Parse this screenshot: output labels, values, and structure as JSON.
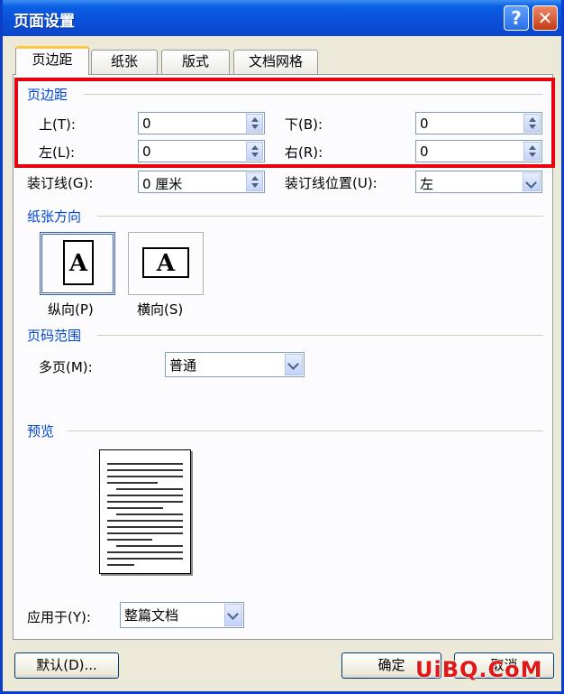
{
  "window": {
    "title": "页面设置",
    "help_glyph": "?",
    "close_glyph": "✕"
  },
  "tabs": [
    {
      "label": "页边距",
      "active": true
    },
    {
      "label": "纸张",
      "active": false
    },
    {
      "label": "版式",
      "active": false
    },
    {
      "label": "文档网格",
      "active": false
    }
  ],
  "margins": {
    "group_title": "页边距",
    "top_label": "上(T):",
    "top_value": "0",
    "bottom_label": "下(B):",
    "bottom_value": "0",
    "left_label": "左(L):",
    "left_value": "0",
    "right_label": "右(R):",
    "right_value": "0",
    "gutter_label": "装订线(G):",
    "gutter_value": "0 厘米",
    "gutter_pos_label": "装订线位置(U):",
    "gutter_pos_value": "左"
  },
  "orientation": {
    "group_title": "纸张方向",
    "glyph": "A",
    "portrait_label": "纵向(P)",
    "landscape_label": "横向(S)",
    "selected": "portrait"
  },
  "pages": {
    "group_title": "页码范围",
    "multiple_label": "多页(M):",
    "multiple_value": "普通"
  },
  "preview": {
    "group_title": "预览",
    "apply_label": "应用于(Y):",
    "apply_value": "整篇文档"
  },
  "footer": {
    "default_label": "默认(D)...",
    "ok_label": "确定",
    "cancel_label": "取消"
  },
  "watermark": {
    "text": "UiBQ.CoM"
  },
  "colors": {
    "group_title": "#0046d5",
    "highlight": "#e8000d",
    "titlebar": "#0a4fd8"
  }
}
